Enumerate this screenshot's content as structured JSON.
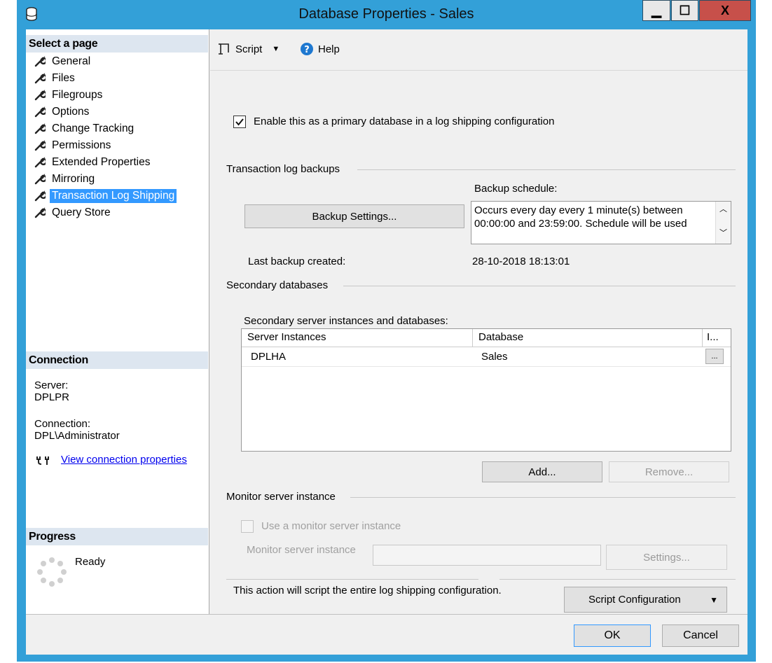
{
  "window": {
    "title": "Database Properties - Sales",
    "minimize_glyph": "▁",
    "maximize_glyph": "☐",
    "close_glyph": "X"
  },
  "left": {
    "select_page_heading": "Select a page",
    "pages": [
      {
        "label": "General"
      },
      {
        "label": "Files"
      },
      {
        "label": "Filegroups"
      },
      {
        "label": "Options"
      },
      {
        "label": "Change Tracking"
      },
      {
        "label": "Permissions"
      },
      {
        "label": "Extended Properties"
      },
      {
        "label": "Mirroring"
      },
      {
        "label": "Transaction Log Shipping",
        "selected": true
      },
      {
        "label": "Query Store"
      }
    ],
    "connection_heading": "Connection",
    "server_label": "Server:",
    "server_value": "DPLPR",
    "connection_label": "Connection:",
    "connection_value": "DPL\\Administrator",
    "view_connection_link": "View connection properties",
    "progress_heading": "Progress",
    "progress_status": "Ready"
  },
  "toolbar": {
    "script_label": "Script",
    "help_label": "Help"
  },
  "main": {
    "enable_primary_label": "Enable this as a primary database in a log shipping configuration",
    "enable_primary_checked": true,
    "tlog_section_label": "Transaction log backups",
    "backup_settings_button": "Backup Settings...",
    "backup_schedule_label": "Backup schedule:",
    "backup_schedule_text": "Occurs every day every 1 minute(s) between 00:00:00 and 23:59:00. Schedule will be used",
    "last_backup_label": "Last backup created:",
    "last_backup_value": "28-10-2018 18:13:01",
    "secondary_section_label": "Secondary databases",
    "secondary_grid_label": "Secondary server instances and databases:",
    "grid_headers": [
      "Server Instances",
      "Database",
      "I..."
    ],
    "grid_rows": [
      {
        "server": "DPLHA",
        "database": "Sales",
        "action": "..."
      }
    ],
    "add_button": "Add...",
    "remove_button": "Remove...",
    "monitor_section_label": "Monitor server instance",
    "use_monitor_label": "Use a monitor server instance",
    "monitor_instance_label": "Monitor server instance",
    "monitor_settings_button": "Settings...",
    "script_note": "This action will script the entire log shipping configuration.",
    "script_config_button": "Script Configuration"
  },
  "footer": {
    "ok_button": "OK",
    "cancel_button": "Cancel"
  },
  "colors": {
    "title_bar": "#33a0d8",
    "selection": "#3399ff",
    "close_button": "#c7504a",
    "link": "#0000ee"
  }
}
